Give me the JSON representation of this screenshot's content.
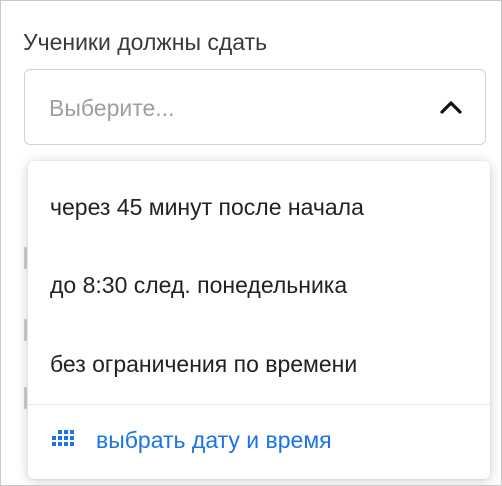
{
  "field": {
    "label": "Ученики должны сдать",
    "select_placeholder": "Выберите...",
    "chevron_icon": "chevron-up-icon"
  },
  "dropdown": {
    "options": [
      {
        "label": "через 45 минут после начала"
      },
      {
        "label": "до 8:30 след. понедельника"
      },
      {
        "label": "без ограничения по времени"
      }
    ],
    "pick_datetime": {
      "label": "выбрать дату и время",
      "icon": "calendar-grid-icon"
    }
  },
  "colors": {
    "accent": "#1a73e8",
    "text": "#222222",
    "placeholder": "#9e9e9e",
    "border": "#d2d2d2"
  }
}
